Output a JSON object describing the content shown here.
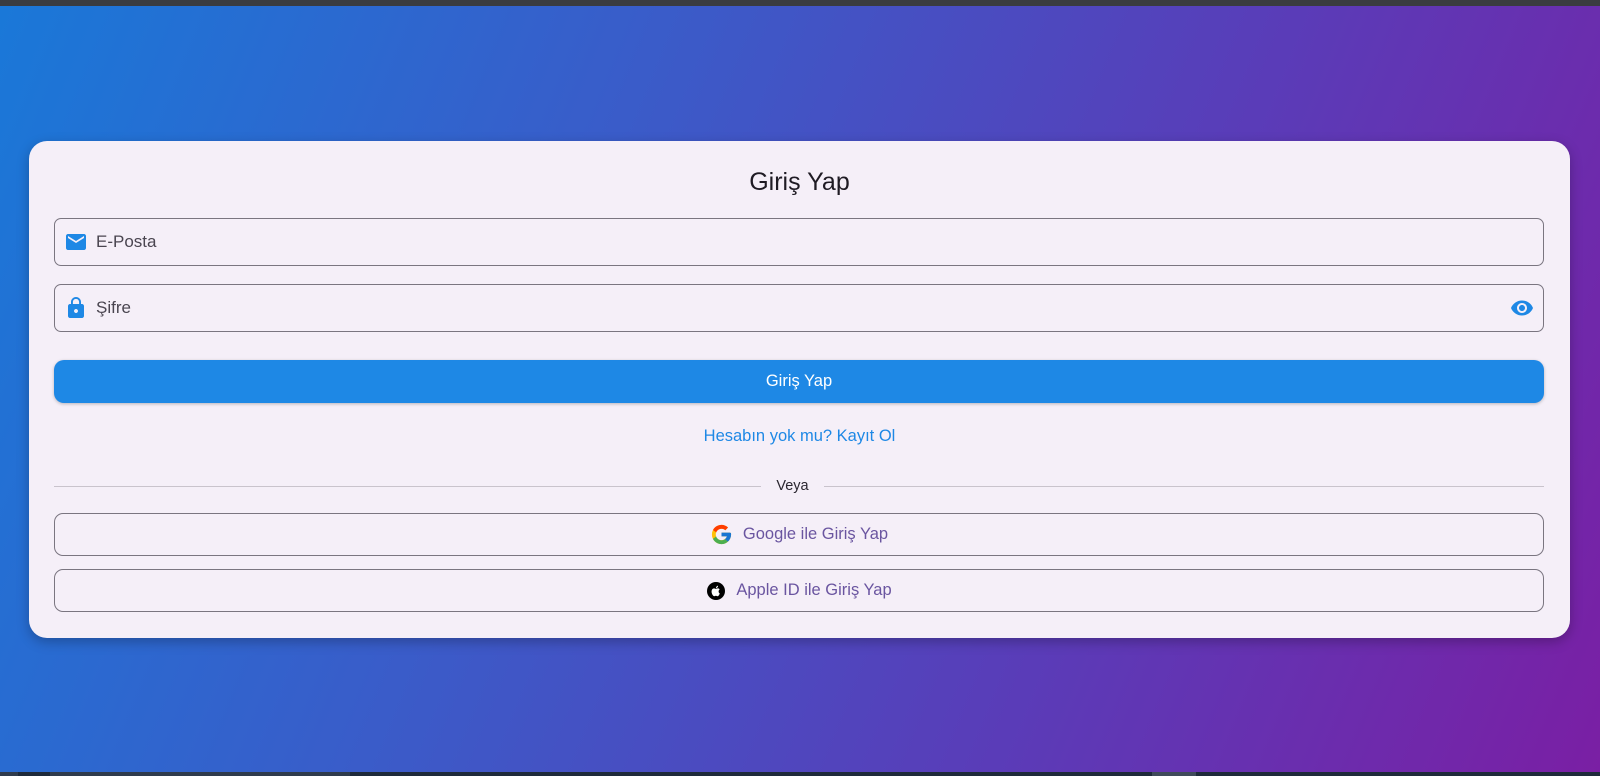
{
  "login": {
    "title": "Giriş Yap",
    "email_placeholder": "E-Posta",
    "password_placeholder": "Şifre",
    "submit_label": "Giriş Yap",
    "register_link": "Hesabın yok mu? Kayıt Ol",
    "divider_text": "Veya",
    "google_label": "Google ile Giriş Yap",
    "apple_label": "Apple ID ile Giriş Yap"
  },
  "icons": {
    "email": "mail-icon",
    "password": "lock-icon",
    "visibility": "eye-icon",
    "google": "google-logo-icon",
    "apple": "apple-logo-icon"
  },
  "colors": {
    "primary": "#1e88e5",
    "card_background": "#f5eff8",
    "gradient_start": "#1a78d8",
    "gradient_end": "#7a1fa4",
    "social_text": "#6a55a0"
  }
}
